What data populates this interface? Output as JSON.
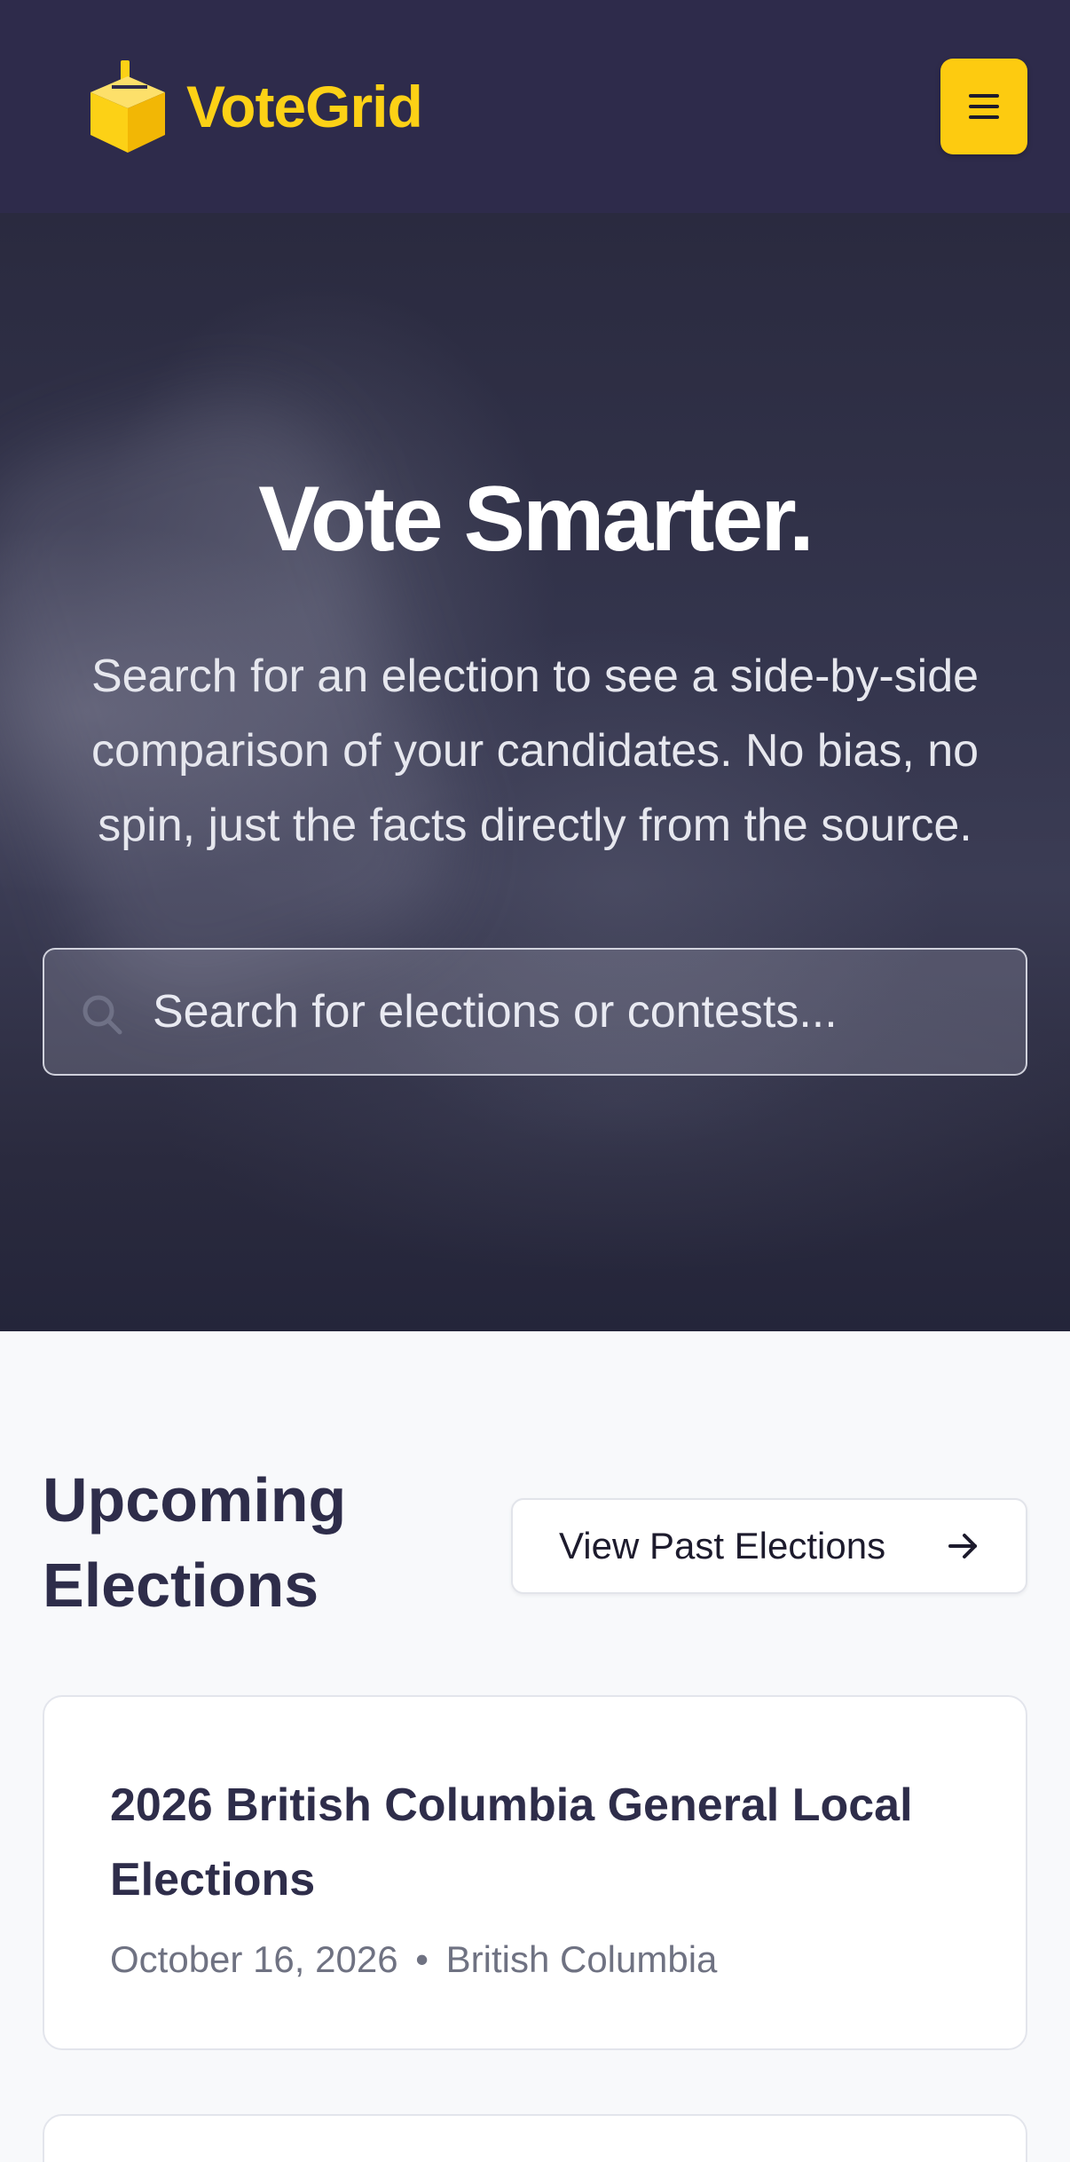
{
  "header": {
    "brand_name": "VoteGrid",
    "logo_icon": "ballot-box-icon",
    "menu_icon": "hamburger-menu-icon",
    "brand_color": "#fcd116",
    "background_color": "#2e2b4b"
  },
  "hero": {
    "title": "Vote Smarter.",
    "subtitle": "Search for an election to see a side-by-side comparison of your candidates. No bias, no spin, just the facts directly from the source.",
    "search": {
      "placeholder": "Search for elections or contests...",
      "value": "",
      "icon": "search-icon"
    }
  },
  "upcoming": {
    "title": "Upcoming Elections",
    "past_button_label": "View Past Elections",
    "past_button_icon": "arrow-right-icon",
    "elections": [
      {
        "title": "2026 British Columbia General Local Elections",
        "date": "October 16, 2026",
        "separator": "•",
        "region": "British Columbia"
      }
    ]
  }
}
